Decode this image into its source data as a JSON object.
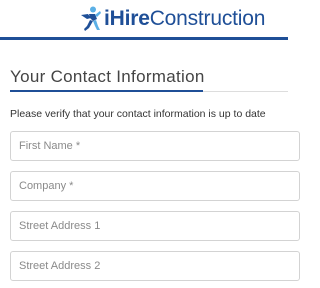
{
  "header": {
    "logo_ihire": "iHire",
    "logo_construction": "Construction"
  },
  "form": {
    "title": "Your Contact Information",
    "instructions": "Please verify that your contact information is up to date",
    "fields": [
      {
        "placeholder": "First Name *",
        "value": ""
      },
      {
        "placeholder": "Company *",
        "value": ""
      },
      {
        "placeholder": "Street Address 1",
        "value": ""
      },
      {
        "placeholder": "Street Address 2",
        "value": ""
      }
    ]
  },
  "colors": {
    "brand": "#1f4f97",
    "accent": "#5bb0e6"
  }
}
